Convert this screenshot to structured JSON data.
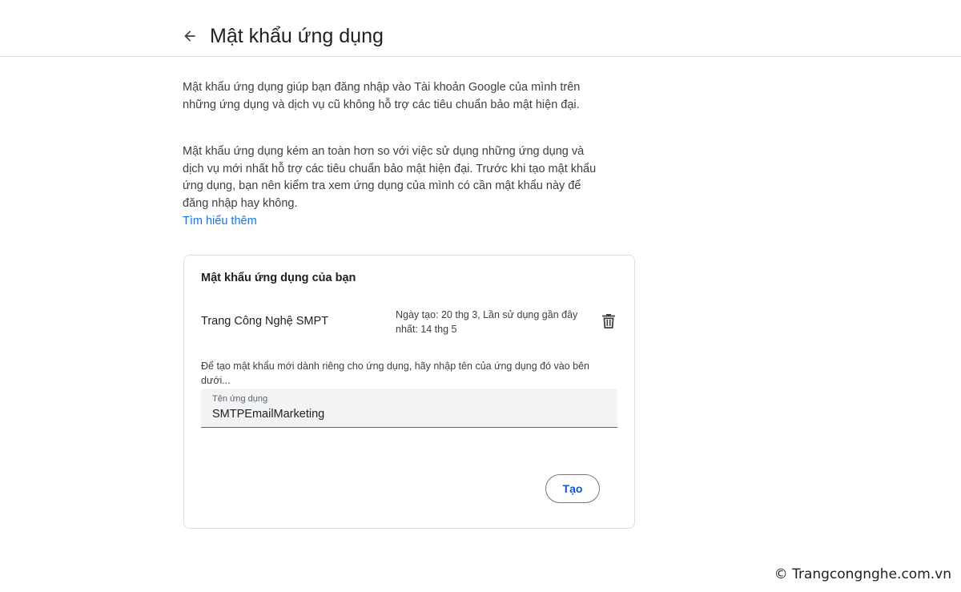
{
  "header": {
    "title": "Mật khẩu ứng dụng",
    "back_icon": "arrow-back-icon"
  },
  "intro": {
    "paragraph1": "Mật khẩu ứng dụng giúp bạn đăng nhập vào Tài khoản Google của mình trên những ứng dụng và dịch vụ cũ không hỗ trợ các tiêu chuẩn bảo mật hiện đại.",
    "paragraph2": "Mật khẩu ứng dụng kém an toàn hơn so với việc sử dụng những ứng dụng và dịch vụ mới nhất hỗ trợ các tiêu chuẩn bảo mật hiện đại. Trước khi tạo mật khẩu ứng dụng, bạn nên kiểm tra xem ứng dụng của mình có cần mật khẩu này để đăng nhập hay không.",
    "learn_more": "Tìm hiểu thêm"
  },
  "card": {
    "title": "Mật khẩu ứng dụng của bạn",
    "apps": [
      {
        "name": "Trang Công Nghệ SMPT",
        "meta": "Ngày tạo: 20 thg 3, Lần sử dụng gần đây nhất: 14 thg 5",
        "delete_icon": "trash-icon"
      }
    ],
    "hint": "Để tạo mật khẩu mới dành riêng cho ứng dụng, hãy nhập tên của ứng dụng đó vào bên dưới...",
    "field": {
      "label": "Tên ứng dụng",
      "value": "SMTPEmailMarketing"
    },
    "create_button": "Tạo"
  },
  "watermark": "© Trangcongnghe.com.vn",
  "colors": {
    "link": "#1a73e8",
    "button_text": "#0b57d0",
    "field_bg": "#f1f3f4",
    "divider": "#dadce0"
  }
}
